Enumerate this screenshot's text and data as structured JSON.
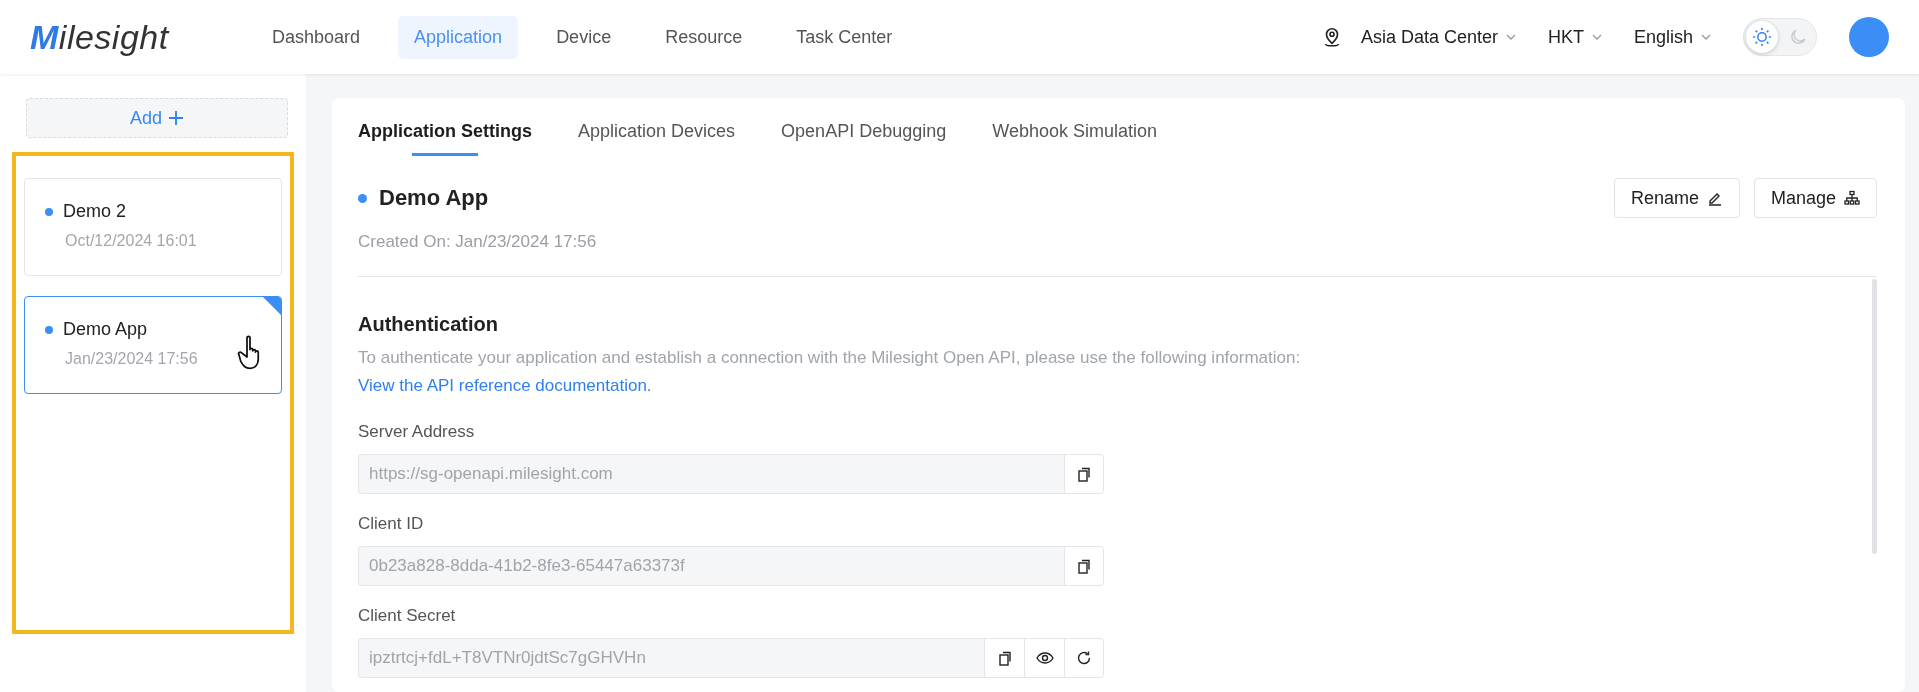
{
  "header": {
    "logo": "Milesight",
    "nav": [
      {
        "label": "Dashboard",
        "selected": false
      },
      {
        "label": "Application",
        "selected": true
      },
      {
        "label": "Device",
        "selected": false
      },
      {
        "label": "Resource",
        "selected": false
      },
      {
        "label": "Task Center",
        "selected": false
      }
    ],
    "region": "Asia Data Center",
    "timezone": "HKT",
    "language": "English",
    "theme": [
      {
        "kind": "light",
        "selected": true
      },
      {
        "kind": "dark",
        "selected": false
      }
    ]
  },
  "sidebar": {
    "add_button": "Add",
    "highlighted": true,
    "apps": [
      {
        "name": "Demo 2",
        "date": "Oct/12/2024 16:01",
        "selected": false
      },
      {
        "name": "Demo App",
        "date": "Jan/23/2024 17:56",
        "selected": true
      }
    ]
  },
  "tabs": [
    {
      "label": "Application Settings",
      "selected": true
    },
    {
      "label": "Application Devices",
      "selected": false
    },
    {
      "label": "OpenAPI Debugging",
      "selected": false
    },
    {
      "label": "Webhook Simulation",
      "selected": false
    }
  ],
  "app": {
    "name": "Demo App",
    "created": "Created On: Jan/23/2024 17:56",
    "buttons": [
      {
        "label": "Rename",
        "kind": "edit"
      },
      {
        "label": "Manage",
        "kind": "hierarchy"
      }
    ]
  },
  "authentication": {
    "title": "Authentication",
    "description": "To authenticate your application and establish a connection with the Milesight Open API, please use the following information:",
    "link": "View the API reference documentation.",
    "fields": [
      {
        "label": "Server Address",
        "value": "https://sg-openapi.milesight.com",
        "actions": [
          {
            "kind": "copy"
          }
        ]
      },
      {
        "label": "Client ID",
        "value": "0b23a828-8dda-41b2-8fe3-65447a63373f",
        "actions": [
          {
            "kind": "copy"
          }
        ]
      },
      {
        "label": "Client Secret",
        "value": "ipztrtcj+fdL+T8VTNr0jdtSc7gGHVHn",
        "actions": [
          {
            "kind": "copy"
          },
          {
            "kind": "view"
          },
          {
            "kind": "refresh"
          }
        ]
      }
    ]
  }
}
